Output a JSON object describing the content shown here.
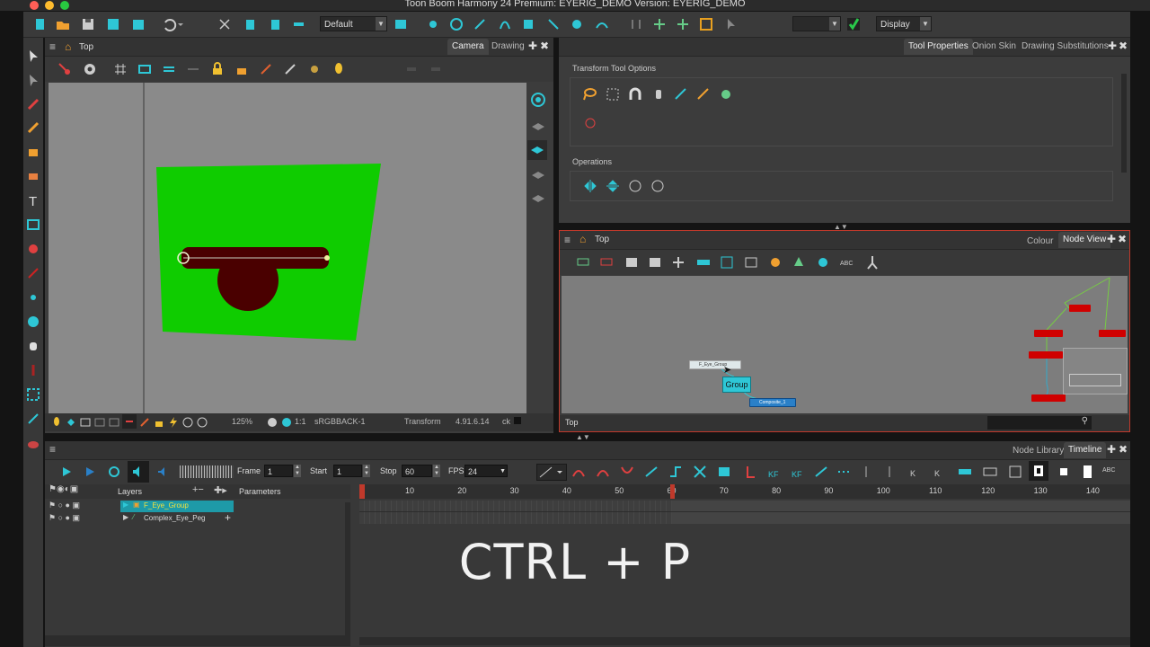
{
  "app": {
    "title": "Toon Boom Harmony 24 Premium: EYERIG_DEMO Version: EYERIG_DEMO"
  },
  "toolbar": {
    "workspace_combo": "Default",
    "display_combo": "Display"
  },
  "camera_panel": {
    "breadcrumb": "Top",
    "tabs": [
      "Camera",
      "Drawing"
    ],
    "status": {
      "zoom": "125%",
      "ratio": "1:1",
      "colorspace": "sRGB",
      "layer": "BACK-1",
      "tool": "Transform",
      "coords": "4.91.6.14",
      "extra": "ck"
    }
  },
  "tool_properties": {
    "tabs": [
      "Tool Properties",
      "Onion Skin",
      "Drawing Substitutions"
    ],
    "section_transform": "Transform Tool Options",
    "section_operations": "Operations"
  },
  "node_view": {
    "breadcrumb": "Top",
    "tabs": [
      "Colour",
      "Node View"
    ],
    "group_label": "Group",
    "footer_label": "Top",
    "small_node_a": "F_Eye_Group",
    "small_node_b": "Composite_1"
  },
  "timeline": {
    "tabs": [
      "Node Library",
      "Timeline"
    ],
    "frame_label": "Frame",
    "frame_value": "1",
    "start_label": "Start",
    "start_value": "1",
    "stop_label": "Stop",
    "stop_value": "60",
    "fps_label": "FPS",
    "fps_value": "24",
    "layers_header": "Layers",
    "parameters_header": "Parameters",
    "layers": [
      {
        "name": "F_Eye_Group",
        "selected": true
      },
      {
        "name": "Complex_Eye_Peg",
        "selected": false
      }
    ],
    "ruler": [
      "10",
      "20",
      "30",
      "40",
      "50",
      "60",
      "70",
      "80",
      "90",
      "100",
      "110",
      "120",
      "130",
      "140"
    ],
    "playhead_frame": 1,
    "stop_frame": 60
  },
  "overlay_caption": "CTRL + P",
  "colors": {
    "accent": "#2ec7d6",
    "green_bg": "#0fcc00",
    "dark_red": "#4a0000",
    "selection": "#1e9aa8",
    "red_frame": "#c0392b"
  }
}
